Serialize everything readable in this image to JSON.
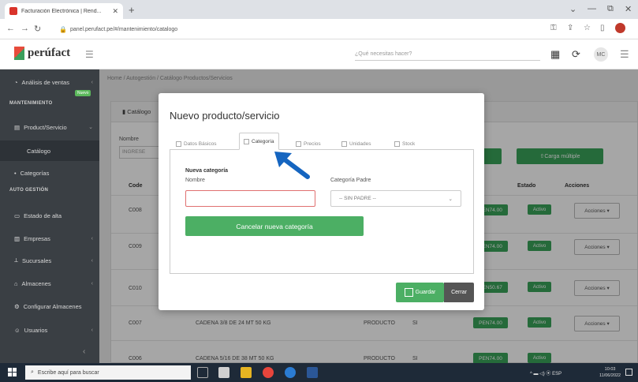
{
  "browser": {
    "tab_title": "Facturación Electrónica | Rend...",
    "url": "panel.perufact.pe/#/mantenimiento/catalogo",
    "minimize": "⌄",
    "window_min": "—",
    "window_max": "⧉",
    "window_close": "✕"
  },
  "header": {
    "logo": "perúfact",
    "search_placeholder": "¿Qué necesitas hacer?",
    "avatar": "MC"
  },
  "sidebar": {
    "item_analisis": "Análisis de ventas",
    "badge_nuevo": "Nuevo",
    "section_mant": "MANTENIMIENTO",
    "item_producto": "Product/Servicio",
    "item_catalogo": "Catálogo",
    "item_categorias": "Categorías",
    "section_auto": "AUTO GESTIÓN",
    "item_estado": "Estado de alta",
    "item_empresas": "Empresas",
    "item_sucursales": "Sucursales",
    "item_almacenes": "Almacenes",
    "item_config_alm": "Configurar Almacenes",
    "item_usuarios": "Usuarios"
  },
  "main": {
    "breadcrumb": "Home / Autogestión / Catálogo Productos/Servicios",
    "panel_title": "Catálogo",
    "nombre_label": "Nombre",
    "nombre_placeholder": "INGRESE",
    "btn_carga_multiple": "Carga múltiple",
    "col_code": "Code",
    "col_estado": "Estado",
    "col_acciones": "Acciones",
    "rows": [
      {
        "code": "C008",
        "desc": "",
        "type": "",
        "igv": "",
        "price": "PEN74.00",
        "state": "Activo",
        "action": "Acciones ▾"
      },
      {
        "code": "C009",
        "desc": "",
        "type": "",
        "igv": "",
        "price": "PEN74.00",
        "state": "Activo",
        "action": "Acciones ▾"
      },
      {
        "code": "C010",
        "desc": "",
        "type": "",
        "igv": "",
        "price": "PEN50.67",
        "state": "Activo",
        "action": "Acciones ▾"
      },
      {
        "code": "C007",
        "desc": "CADENA 3/8 DE 24 MT 50 KG",
        "type": "PRODUCTO",
        "igv": "SI",
        "price": "PEN74.00",
        "state": "Activo",
        "action": "Acciones ▾"
      },
      {
        "code": "C006",
        "desc": "CADENA 5/16 DE 38 MT 50 KG",
        "type": "PRODUCTO",
        "igv": "SI",
        "price": "PEN74.00",
        "state": "Activo",
        "action": "Acciones ▾"
      }
    ]
  },
  "modal": {
    "title": "Nuevo producto/servicio",
    "tabs": [
      "Datos Básicos",
      "Categoría",
      "Precios",
      "Unidades",
      "Stock"
    ],
    "nueva_categoria": "Nueva categoría",
    "nombre": "Nombre",
    "categoria_padre": "Categoría Padre",
    "select_value": "-- SIN PADRE --",
    "btn_cancelar_categoria": "Cancelar nueva categoría",
    "btn_guardar": "Guardar",
    "btn_cerrar": "Cerrar"
  },
  "taskbar": {
    "search": "Escribe aquí para buscar",
    "tray": "ESP",
    "time": "10:03",
    "date": "11/06/2022"
  }
}
